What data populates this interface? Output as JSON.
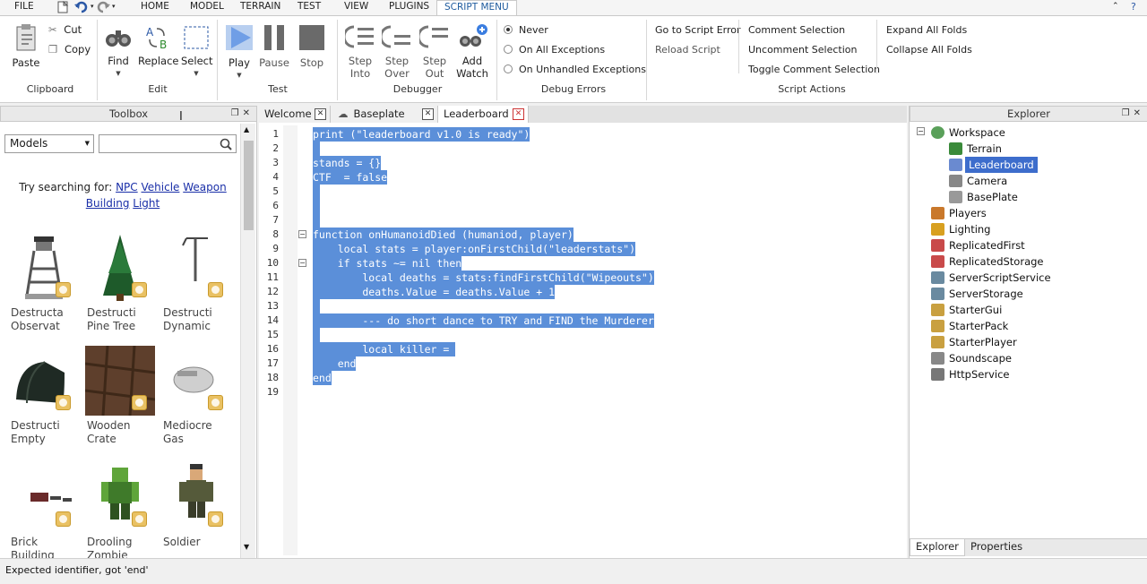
{
  "menubar": {
    "file": "FILE",
    "tabs": [
      "HOME",
      "MODEL",
      "TERRAIN",
      "TEST",
      "VIEW",
      "PLUGINS",
      "SCRIPT MENU"
    ]
  },
  "ribbon": {
    "clipboard": {
      "paste": "Paste",
      "cut": "Cut",
      "copy": "Copy",
      "label": "Clipboard"
    },
    "edit": {
      "find": "Find",
      "replace": "Replace",
      "select": "Select",
      "label": "Edit"
    },
    "test": {
      "play": "Play",
      "pause": "Pause",
      "stop": "Stop",
      "label": "Test"
    },
    "debugger": {
      "step_into": [
        "Step",
        "Into"
      ],
      "step_over": [
        "Step",
        "Over"
      ],
      "step_out": [
        "Step",
        "Out"
      ],
      "add_watch": [
        "Add",
        "Watch"
      ],
      "label": "Debugger"
    },
    "debug_errors": {
      "options": [
        "Never",
        "On All Exceptions",
        "On Unhandled Exceptions"
      ],
      "selected": "Never",
      "label": "Debug Errors"
    },
    "script_actions": {
      "col1": [
        "Go to Script Error",
        "Reload Script"
      ],
      "col2": [
        "Comment Selection",
        "Uncomment Selection",
        "Toggle Comment Selection"
      ],
      "col3": [
        "Expand All Folds",
        "Collapse All Folds"
      ],
      "label": "Script Actions"
    }
  },
  "toolbox": {
    "title": "Toolbox",
    "category": "Models",
    "search_placeholder": "",
    "hint_prefix": "Try searching for:",
    "suggestions": [
      "NPC",
      "Vehicle",
      "Weapon",
      "Building",
      "Light"
    ],
    "items": [
      {
        "name": [
          "Destructa",
          "Observat"
        ]
      },
      {
        "name": [
          "Destructi",
          "Pine Tree"
        ]
      },
      {
        "name": [
          "Destructi",
          "Dynamic"
        ]
      },
      {
        "name": [
          "Destructi",
          "Empty"
        ]
      },
      {
        "name": [
          "Wooden",
          "Crate"
        ]
      },
      {
        "name": [
          "Mediocre",
          "Gas"
        ]
      },
      {
        "name": [
          "Brick",
          "Building"
        ]
      },
      {
        "name": [
          "Drooling",
          "Zombie"
        ]
      },
      {
        "name": [
          "Soldier",
          ""
        ]
      }
    ]
  },
  "editor": {
    "tabs": [
      "Welcome",
      "Baseplate",
      "Leaderboard"
    ],
    "active_tab": "Leaderboard",
    "lines": [
      "print (\"leaderboard v1.0 is ready\")",
      "",
      "stands = {}",
      "CTF  = false",
      "",
      "",
      "",
      "function onHumanoidDied (humaniod, player)",
      "    local stats = player:onFirstChild(\"leaderstats\")",
      "    if stats ~= nil then",
      "        local deaths = stats:findFirstChild(\"Wipeouts\")",
      "        deaths.Value = deaths.Value + 1",
      "",
      "        --- do short dance to TRY and FIND the Murderer",
      "",
      "        local killer = ",
      "    end",
      "end",
      ""
    ],
    "line_numbers": [
      "1",
      "2",
      "3",
      "4",
      "5",
      "6",
      "7",
      "8",
      "9",
      "10",
      "11",
      "12",
      "13",
      "14",
      "15",
      "16",
      "17",
      "18",
      "19"
    ]
  },
  "explorer": {
    "title": "Explorer",
    "items": [
      "Workspace",
      "Terrain",
      "Leaderboard",
      "Camera",
      "BasePlate",
      "Players",
      "Lighting",
      "ReplicatedFirst",
      "ReplicatedStorage",
      "ServerScriptService",
      "ServerStorage",
      "StarterGui",
      "StarterPack",
      "StarterPlayer",
      "Soundscape",
      "HttpService"
    ],
    "selected": "Leaderboard",
    "bottom_tabs": [
      "Explorer",
      "Properties"
    ]
  },
  "status": {
    "message": "Expected identifier, got 'end'"
  },
  "colors": {
    "selection": "#5b8fd9",
    "tree_selection": "#3d6dcc",
    "link": "#1a2fa8",
    "ribbon_bg": "#ffffff"
  }
}
